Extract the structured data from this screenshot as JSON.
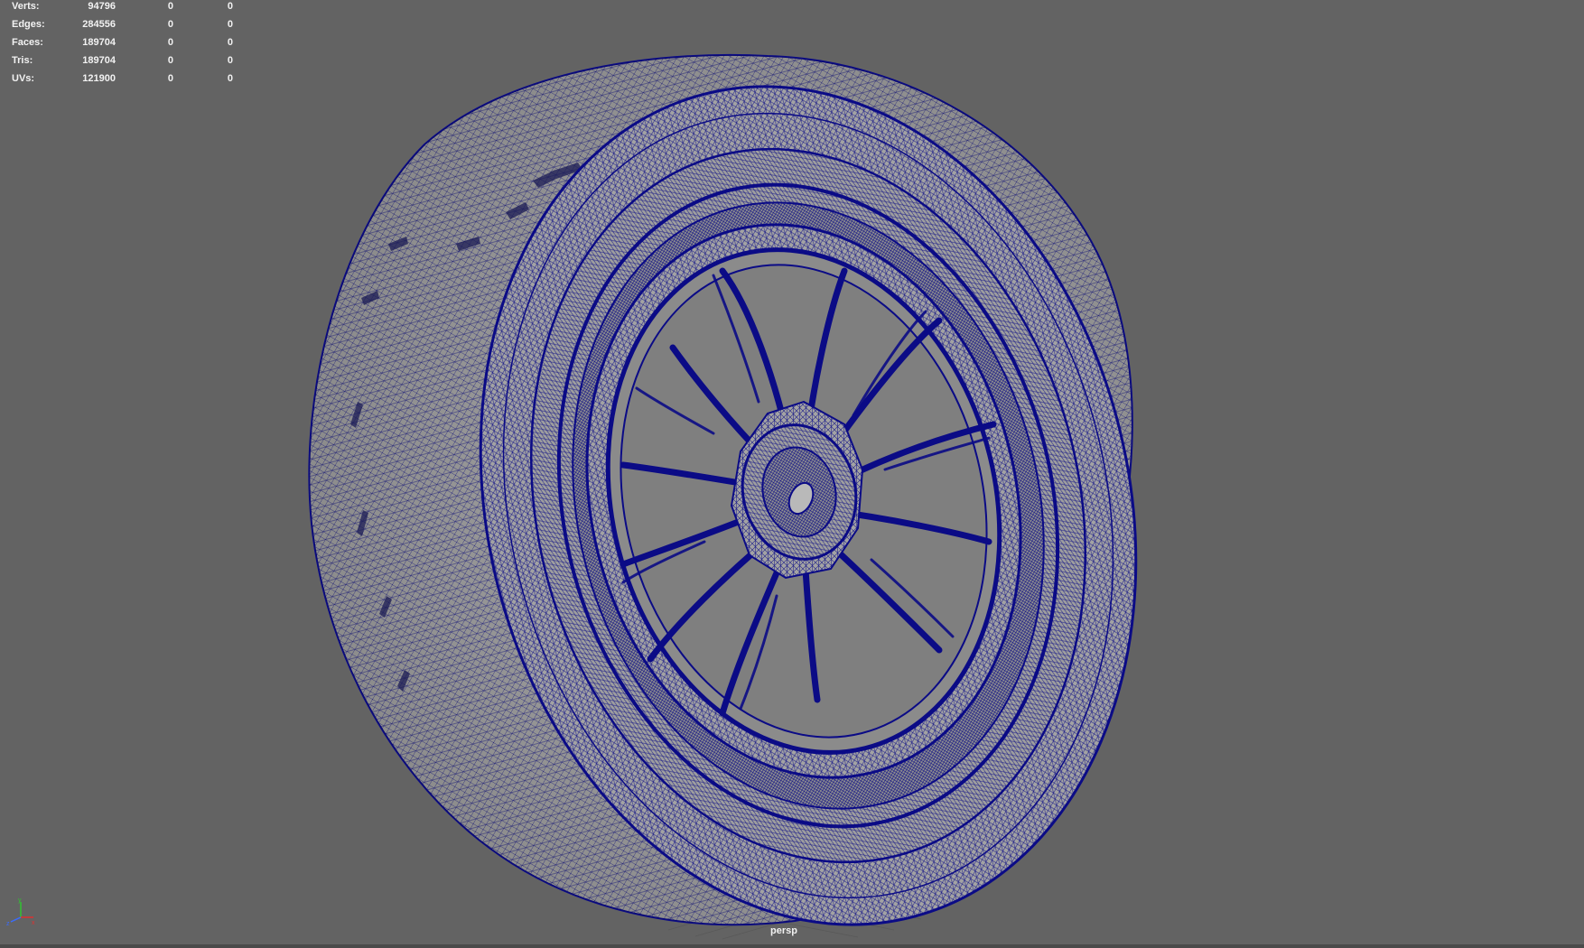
{
  "hud": {
    "rows": [
      {
        "label": "Verts:",
        "v1": "94796",
        "v2": "0",
        "v3": "0"
      },
      {
        "label": "Edges:",
        "v1": "284556",
        "v2": "0",
        "v3": "0"
      },
      {
        "label": "Faces:",
        "v1": "189704",
        "v2": "0",
        "v3": "0"
      },
      {
        "label": "Tris:",
        "v1": "189704",
        "v2": "0",
        "v3": "0"
      },
      {
        "label": "UVs:",
        "v1": "121900",
        "v2": "0",
        "v3": "0"
      }
    ]
  },
  "viewport": {
    "camera_label": "persp",
    "background_color": "#636363",
    "wireframe_color": "#0b0b86",
    "surface_color": "#a4a4a4"
  },
  "axis": {
    "x_label": "x",
    "y_label": "y",
    "z_label": "z"
  },
  "icons": {
    "axis_gizmo": "axis-gizmo-icon"
  }
}
